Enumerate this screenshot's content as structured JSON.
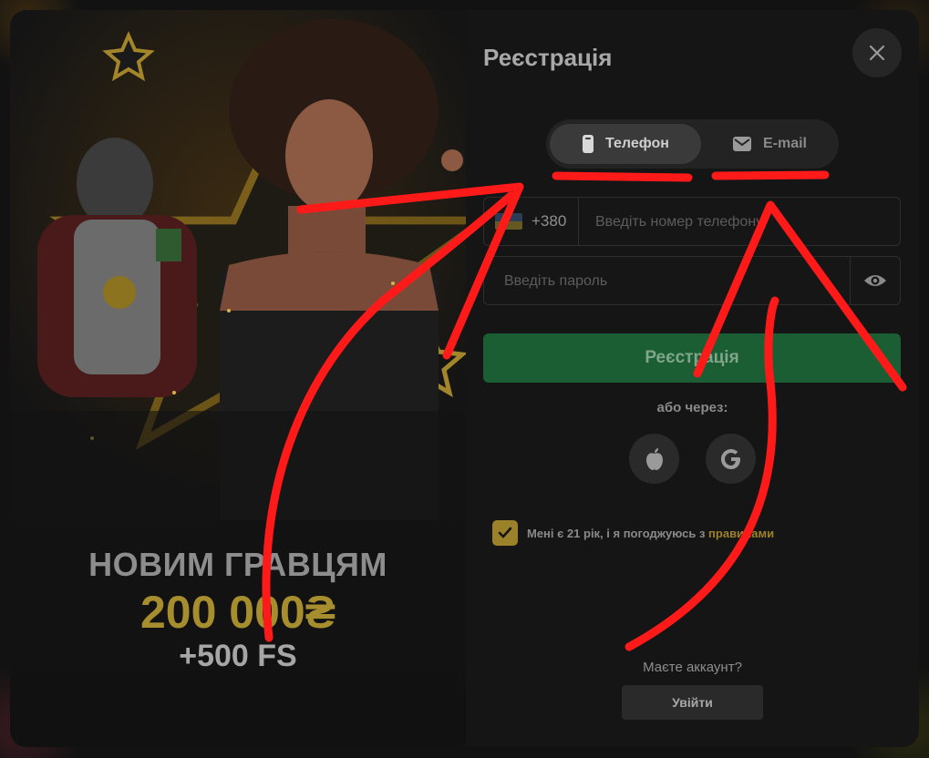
{
  "form": {
    "title": "Реєстрація",
    "tabs": [
      {
        "label": "Телефон",
        "icon": "phone-icon",
        "active": true
      },
      {
        "label": "E-mail",
        "icon": "mail-icon",
        "active": false
      }
    ],
    "phone_prefix": "+380",
    "phone_placeholder": "Введіть номер телефону",
    "password_placeholder": "Введіть пароль",
    "submit_label": "Реєстрація",
    "or_label": "або через:",
    "consent_text": "Мені є 21 рік, і я погоджуюсь з ",
    "consent_link": "правилами",
    "consent_checked": true,
    "has_account_label": "Маєте аккаунт?",
    "login_label": "Увійти"
  },
  "promo": {
    "line1": "НОВИМ ГРАВЦЯМ",
    "line2": "200 000₴",
    "line3": "+500 FS"
  },
  "colors": {
    "accent_gold": "#9b812a",
    "submit_green": "#1c5e33",
    "annotation_red": "#ff1a1a"
  }
}
